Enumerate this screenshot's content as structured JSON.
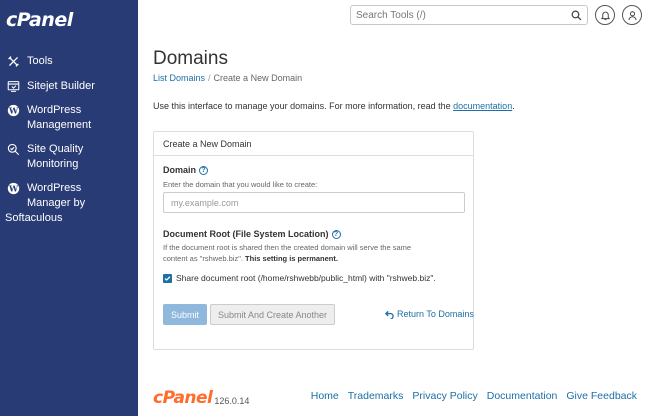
{
  "sidebar": {
    "logo": "cPanel",
    "items": [
      {
        "label": "Tools",
        "icon": "tools-icon"
      },
      {
        "label": "Sitejet Builder",
        "icon": "sitejet-icon"
      },
      {
        "label_line1": "WordPress",
        "label_line2": "Management",
        "icon": "wordpress-icon"
      },
      {
        "label_line1": "Site Quality",
        "label_line2": "Monitoring",
        "icon": "site-quality-icon"
      },
      {
        "label_line1": "WordPress",
        "label_line2": "Manager by",
        "label_line3": "Softaculous",
        "icon": "wordpress-icon"
      }
    ]
  },
  "topbar": {
    "search_placeholder": "Search Tools (/)"
  },
  "page": {
    "title": "Domains",
    "breadcrumb": {
      "parent": "List Domains",
      "separator": "/",
      "current": "Create a New Domain"
    },
    "intro_text": "Use this interface to manage your domains. For more information, read the ",
    "intro_link": "documentation",
    "intro_end": "."
  },
  "form": {
    "panel_title": "Create a New Domain",
    "domain_label": "Domain",
    "domain_hint": "Enter the domain that you would like to create:",
    "domain_placeholder": "my.example.com",
    "docroot_label": "Document Root (File System Location)",
    "docroot_hint_1": "If the document root is shared then the created domain will serve the same",
    "docroot_hint_2": "content as \"rshweb.biz\". ",
    "docroot_hint_bold": "This setting is permanent.",
    "share_checkbox_label": "Share document root (/home/rshwebb/public_html) with \"rshweb.biz\".",
    "share_checked": true,
    "submit_label": "Submit",
    "submit_another_label": "Submit And Create Another",
    "return_label": "Return To Domains"
  },
  "footer": {
    "logo": "cPanel",
    "version": "126.0.14",
    "links": [
      "Home",
      "Trademarks",
      "Privacy Policy",
      "Documentation",
      "Give Feedback"
    ]
  },
  "colors": {
    "sidebar_bg": "#283b74",
    "link": "#1d6fa5",
    "brand_orange": "#ff6c2c",
    "submit_bg": "#8fb8dc"
  }
}
